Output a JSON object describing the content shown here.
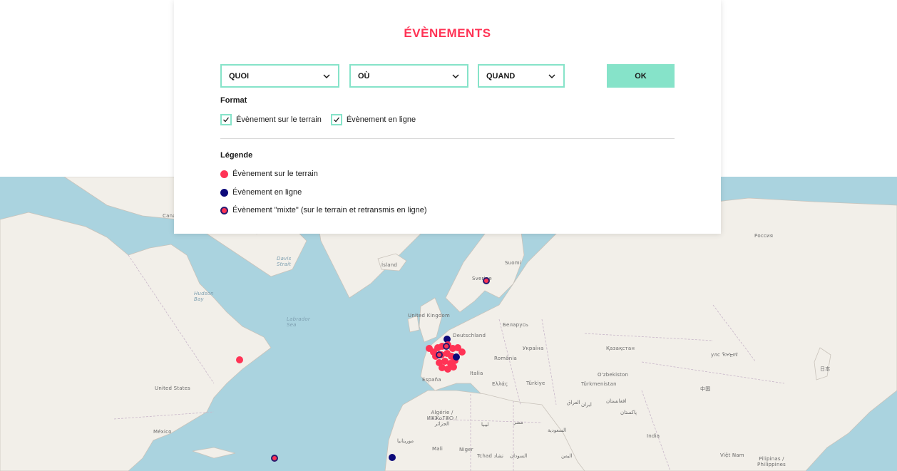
{
  "panel": {
    "title": "ÉVÈNEMENTS",
    "filters": {
      "what": "QUOI",
      "where": "OÙ",
      "when": "QUAND",
      "ok_label": "OK"
    },
    "format": {
      "label": "Format",
      "options": [
        {
          "label": "Évènement sur le terrain",
          "checked": true
        },
        {
          "label": "Évènement en ligne",
          "checked": true
        }
      ]
    },
    "legend": {
      "label": "Légende",
      "items": [
        {
          "label": "Évènement sur le terrain",
          "type": "terrain"
        },
        {
          "label": "Évènement en ligne",
          "type": "online"
        },
        {
          "label": "Évènement \"mixte\" (sur le terrain et retransmis en ligne)",
          "type": "mixte"
        }
      ]
    }
  },
  "map": {
    "labels": {
      "canada": "Cana",
      "usa": "United States",
      "mexico": "México",
      "hudson": "Hudson Bay",
      "labrador": "Labrador Sea",
      "davis": "Davis Strait",
      "island": "Ísland",
      "uk": "United Kingdom",
      "germany": "Deutschland",
      "sverige": "Sverige",
      "suomi": "Suomi",
      "belarus": "Беларусь",
      "ukraine": "Україна",
      "romania": "România",
      "italia": "Italia",
      "espana": "España",
      "ellas": "Ελλάς",
      "turkiye": "Türkiye",
      "kazakhstan": "Қазақстан",
      "uzbekistan": "O'zbekiston",
      "turkmenistan": "Türkmenistan",
      "russia": "Россия",
      "mongolia": "улс ᠮᠣᠩᠭᠣᠯ",
      "china": "中国",
      "japan": "日本",
      "iraq": "العراق",
      "iran": "ایران",
      "afghanistan": "افغانستان",
      "pakistan": "پاکستان",
      "india": "India",
      "saudi": "السعودية",
      "egypt": "مصر",
      "libya": "ليبيا",
      "algeria": "Algérie / ⵍⵣⵣⴰⵢⴻⵔ / الجزائر",
      "morocco": "موريتانيا",
      "mali": "Mali",
      "niger": "Niger",
      "tchad": "Tchad تشاد",
      "sudan": "السودان",
      "yemen": "اليمن",
      "vietnam": "Việt Nam",
      "philippines": "Pilipinas / Philippines"
    }
  },
  "colors": {
    "accent": "#ff3355",
    "mint": "#86e3c9",
    "online": "#0d0a7a",
    "water": "#aad3df",
    "land": "#f2efe9"
  }
}
